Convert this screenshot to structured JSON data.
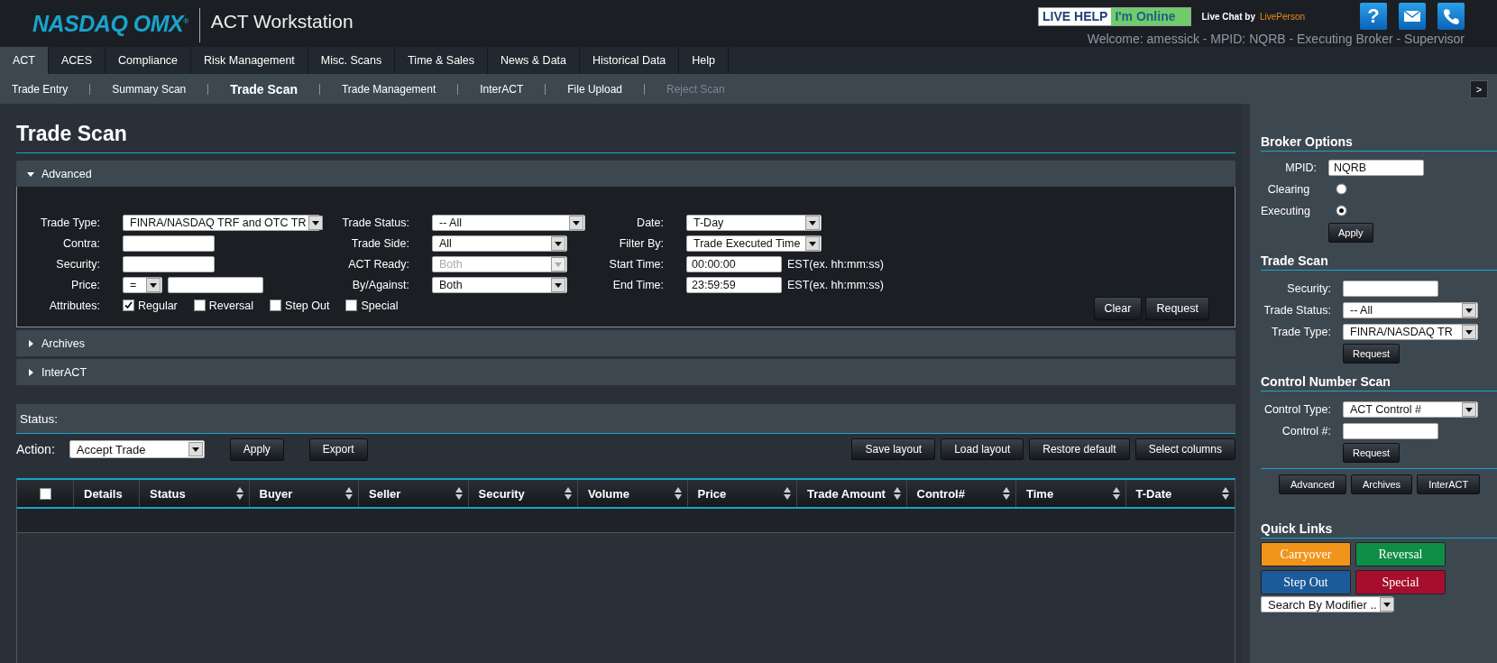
{
  "header": {
    "logo": "NASDAQ OMX$^{®}$",
    "app_title": "ACT Workstation",
    "live_help": {
      "label": "LIVE HELP",
      "status": "I'm Online"
    },
    "live_chat": {
      "label": "Live Chat",
      "by": "by",
      "provider": "LivePerson"
    },
    "help_button": "?",
    "welcome": "Welcome: amessick - MPID: NQRB - Executing Broker - Supervisor"
  },
  "main_tabs": [
    {
      "label": "ACT",
      "selected": true
    },
    {
      "label": "ACES",
      "selected": false
    },
    {
      "label": "Compliance",
      "selected": false
    },
    {
      "label": "Risk Management",
      "selected": false
    },
    {
      "label": "Misc. Scans",
      "selected": false
    },
    {
      "label": "Time & Sales",
      "selected": false
    },
    {
      "label": "News & Data",
      "selected": false
    },
    {
      "label": "Historical Data",
      "selected": false
    },
    {
      "label": "Help",
      "selected": false
    }
  ],
  "sub_nav": [
    {
      "label": "Trade Entry",
      "selected": false,
      "disabled": false
    },
    {
      "label": "Summary Scan",
      "selected": false,
      "disabled": false
    },
    {
      "label": "Trade Scan",
      "selected": true,
      "disabled": false
    },
    {
      "label": "Trade Management",
      "selected": false,
      "disabled": false
    },
    {
      "label": "InterACT",
      "selected": false,
      "disabled": false
    },
    {
      "label": "File Upload",
      "selected": false,
      "disabled": false
    },
    {
      "label": "Reject Scan",
      "selected": false,
      "disabled": true
    }
  ],
  "panel_toggle": ">",
  "page_title": "Trade Scan",
  "sections": [
    {
      "title": "Advanced",
      "expanded": true
    },
    {
      "title": "Archives",
      "expanded": false
    },
    {
      "title": "InterACT",
      "expanded": false
    }
  ],
  "advanced_form": {
    "columns": [
      [
        {
          "label": "Trade Type:",
          "kind": "select",
          "value": "FINRA/NASDAQ TRF and OTC TR",
          "disabled": false
        },
        {
          "label": "Contra:",
          "kind": "input"
        },
        {
          "label": "Security:",
          "kind": "input"
        },
        {
          "label": "Price:",
          "kind": "price",
          "operator": "="
        }
      ],
      [
        {
          "label": "Trade Status:",
          "kind": "select",
          "value": "-- All",
          "disabled": false
        },
        {
          "label": "Trade Side:",
          "kind": "select",
          "value": "All",
          "disabled": false
        },
        {
          "label": "ACT Ready:",
          "kind": "select",
          "value": "Both",
          "disabled": true
        },
        {
          "label": "By/Against:",
          "kind": "select",
          "value": "Both",
          "disabled": false
        }
      ],
      [
        {
          "label": "Date:",
          "kind": "select",
          "value": "T-Day",
          "disabled": false
        },
        {
          "label": "Filter By:",
          "kind": "select",
          "value": "Trade Executed Time",
          "disabled": false
        },
        {
          "label": "Start Time:",
          "kind": "input",
          "value": "00:00:00",
          "suffix": "EST(ex. hh:mm:ss)"
        },
        {
          "label": "End Time:",
          "kind": "input",
          "value": "23:59:59",
          "suffix": "EST(ex. hh:mm:ss)"
        }
      ]
    ],
    "attributes": {
      "label": "Attributes:",
      "options": [
        {
          "label": "Regular",
          "checked": true
        },
        {
          "label": "Reversal",
          "checked": false
        },
        {
          "label": "Step Out",
          "checked": false
        },
        {
          "label": "Special",
          "checked": false
        }
      ]
    },
    "buttons": [
      "Clear",
      "Request"
    ]
  },
  "status_bar": {
    "label": "Status:"
  },
  "action": {
    "label": "Action:",
    "value": "Accept Trade",
    "buttons": [
      "Apply",
      "Export"
    ]
  },
  "layout_buttons": [
    "Save layout",
    "Load layout",
    "Restore default",
    "Select columns"
  ],
  "table": {
    "select_all_checked": false,
    "columns": [
      {
        "label": "Details",
        "sortable": false
      },
      {
        "label": "Status",
        "sortable": true
      },
      {
        "label": "Buyer",
        "sortable": true
      },
      {
        "label": "Seller",
        "sortable": true
      },
      {
        "label": "Security",
        "sortable": true
      },
      {
        "label": "Volume",
        "sortable": true
      },
      {
        "label": "Price",
        "sortable": true
      },
      {
        "label": "Trade Amount",
        "sortable": true
      },
      {
        "label": "Control#",
        "sortable": true
      },
      {
        "label": "Time",
        "sortable": true
      },
      {
        "label": "T-Date",
        "sortable": true
      }
    ]
  },
  "broker_options": {
    "title": "Broker Options",
    "mpid_label": "MPID:",
    "mpid_value": "NQRB",
    "roles": [
      {
        "label": "Clearing",
        "selected": false
      },
      {
        "label": "Executing",
        "selected": true
      }
    ],
    "button": "Apply"
  },
  "trade_scan_panel": {
    "title": "Trade Scan",
    "fields": [
      {
        "label": "Security:",
        "kind": "input"
      },
      {
        "label": "Trade Status:",
        "kind": "select",
        "value": "-- All"
      },
      {
        "label": "Trade Type:",
        "kind": "select",
        "value": "FINRA/NASDAQ TR"
      }
    ],
    "button": "Request"
  },
  "control_scan": {
    "title": "Control Number Scan",
    "fields": [
      {
        "label": "Control Type:",
        "kind": "select",
        "value": "ACT Control #"
      },
      {
        "label": "Control #:",
        "kind": "input"
      }
    ],
    "button": "Request"
  },
  "panel_nav": [
    "Advanced",
    "Archives",
    "InterACT"
  ],
  "quick_links": {
    "title": "Quick Links",
    "links": [
      {
        "label": "Carryover",
        "color": "#f0941c"
      },
      {
        "label": "Reversal",
        "color": "#0f8c45"
      },
      {
        "label": "Step Out",
        "color": "#1c5a9a"
      },
      {
        "label": "Special",
        "color": "#a50f2d"
      }
    ],
    "modifier_select": "Search By Modifier .."
  }
}
